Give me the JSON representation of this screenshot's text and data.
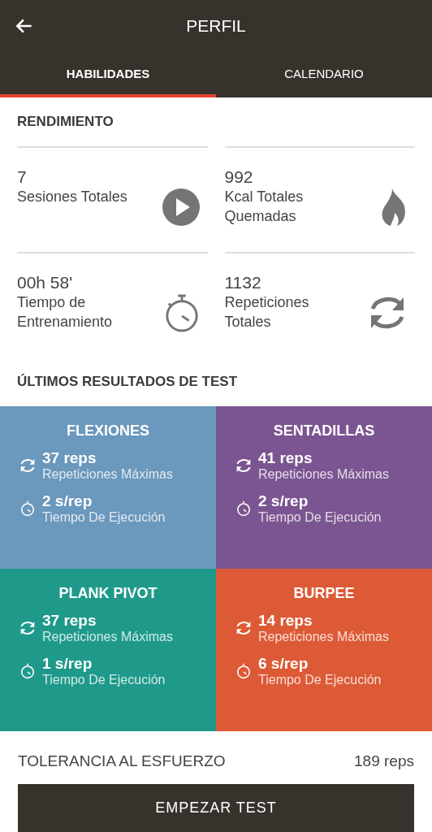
{
  "app_bar": {
    "title": "PERFIL"
  },
  "tabs": [
    {
      "label": "HABILIDADES",
      "selected": true
    },
    {
      "label": "CALENDARIO",
      "selected": false
    }
  ],
  "performance": {
    "title": "RENDIMIENTO",
    "stats": [
      {
        "value": "7",
        "label": "Sesiones Totales",
        "kind": "play"
      },
      {
        "value": "992",
        "label": "Kcal Totales Quemadas",
        "kind": "flame"
      },
      {
        "value": "00h 58'",
        "label": "Tiempo de Entrenamiento",
        "kind": "timer"
      },
      {
        "value": "1132",
        "label": "Repeticiones Totales",
        "kind": "repeat"
      }
    ]
  },
  "test_results": {
    "title": "ÚLTIMOS RESULTADOS DE TEST",
    "tiles": [
      {
        "name": "FLEXIONES",
        "color": "#6b98bd",
        "reps": "37 reps",
        "reps_label": "Repeticiones Máximas",
        "time": "2 s/rep",
        "time_label": "Tiempo De Ejecución"
      },
      {
        "name": "SENTADILLAS",
        "color": "#7b5591",
        "reps": "41 reps",
        "reps_label": "Repeticiones Máximas",
        "time": "2 s/rep",
        "time_label": "Tiempo De Ejecución"
      },
      {
        "name": "PLANK PIVOT",
        "color": "#1f9a8a",
        "reps": "37 reps",
        "reps_label": "Repeticiones Máximas",
        "time": "1 s/rep",
        "time_label": "Tiempo De Ejecución"
      },
      {
        "name": "BURPEE",
        "color": "#dd5a36",
        "reps": "14 reps",
        "reps_label": "Repeticiones Máximas",
        "time": "6 s/rep",
        "time_label": "Tiempo De Ejecución"
      }
    ]
  },
  "endurance": {
    "label": "TOLERANCIA AL ESFUERZO",
    "value": "189 reps"
  },
  "start_button": "EMPEZAR TEST"
}
